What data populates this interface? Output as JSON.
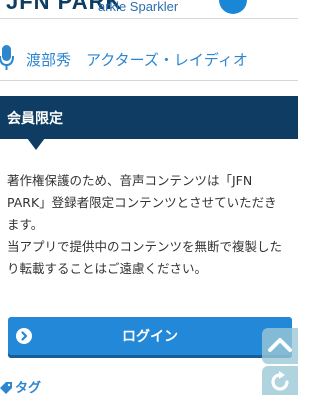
{
  "header": {
    "logo": "JFN PARK",
    "subtitle": "arkle Sparkler"
  },
  "speaker": {
    "name": "渡部秀　アクターズ・レイディオ"
  },
  "section": {
    "title": "会員限定"
  },
  "notice": {
    "lines": [
      "著作権保護のため、音声コンテンツは「JFN",
      "PARK」登録者限定コンテンツとさせていただき",
      "ます。",
      "当アプリで提供中のコンテンツを無断で複製した",
      "り転載することはご遠慮ください。"
    ]
  },
  "login": {
    "label": "ログイン"
  },
  "tag": {
    "label": "タグ"
  },
  "colors": {
    "navy": "#0e3c62",
    "accent_blue": "#2388d8",
    "link_blue": "#2c86d0",
    "floating_button": "#9bc8d7"
  },
  "icons": {
    "mic": "microphone-icon",
    "login_arrow": "circle-arrow-right-icon",
    "tag": "tag-icon",
    "scroll_top": "chevron-up-icon",
    "refresh": "refresh-icon"
  }
}
